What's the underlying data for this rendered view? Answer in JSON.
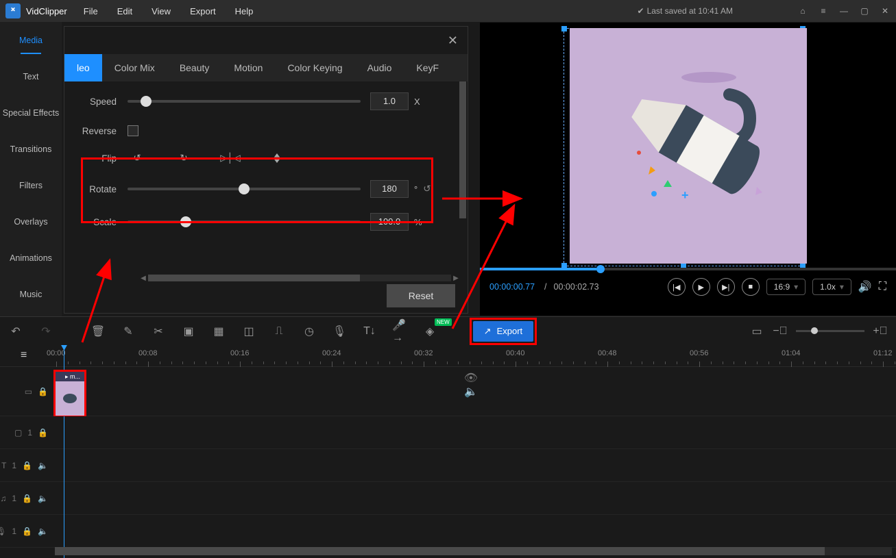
{
  "app": {
    "name": "VidClipper"
  },
  "menu": {
    "file": "File",
    "edit": "Edit",
    "view": "View",
    "export": "Export",
    "help": "Help"
  },
  "status": {
    "last_saved": "Last saved at 10:41 AM"
  },
  "sidebar": {
    "items": [
      "Media",
      "Text",
      "Special Effects",
      "Transitions",
      "Filters",
      "Overlays",
      "Animations",
      "Music"
    ],
    "active": 0
  },
  "editPanel": {
    "tabs": [
      "leo",
      "Color Mix",
      "Beauty",
      "Motion",
      "Color Keying",
      "Audio",
      "KeyF"
    ],
    "activeTab": 0,
    "speed": {
      "label": "Speed",
      "value": "1.0",
      "unit": "X",
      "pct": 8
    },
    "reverse": {
      "label": "Reverse",
      "checked": false
    },
    "flip": {
      "label": "Flip"
    },
    "rotate": {
      "label": "Rotate",
      "value": "180",
      "unit": "°",
      "pct": 50
    },
    "scale": {
      "label": "Scale",
      "value": "100.0",
      "unit": "%",
      "pct": 25
    },
    "reset": "Reset"
  },
  "preview": {
    "current_time": "00:00:00.77",
    "total_time": "00:00:02.73",
    "sep": "/",
    "aspect": "16:9",
    "speed": "1.0x"
  },
  "toolbar": {
    "export_label": "Export",
    "new_badge": "NEW"
  },
  "timeline": {
    "labels": [
      "00:00",
      "00:08",
      "00:16",
      "00:24",
      "00:32",
      "00:40",
      "00:48",
      "00:56",
      "01:04",
      "01:12"
    ],
    "clip_name": "m..."
  }
}
